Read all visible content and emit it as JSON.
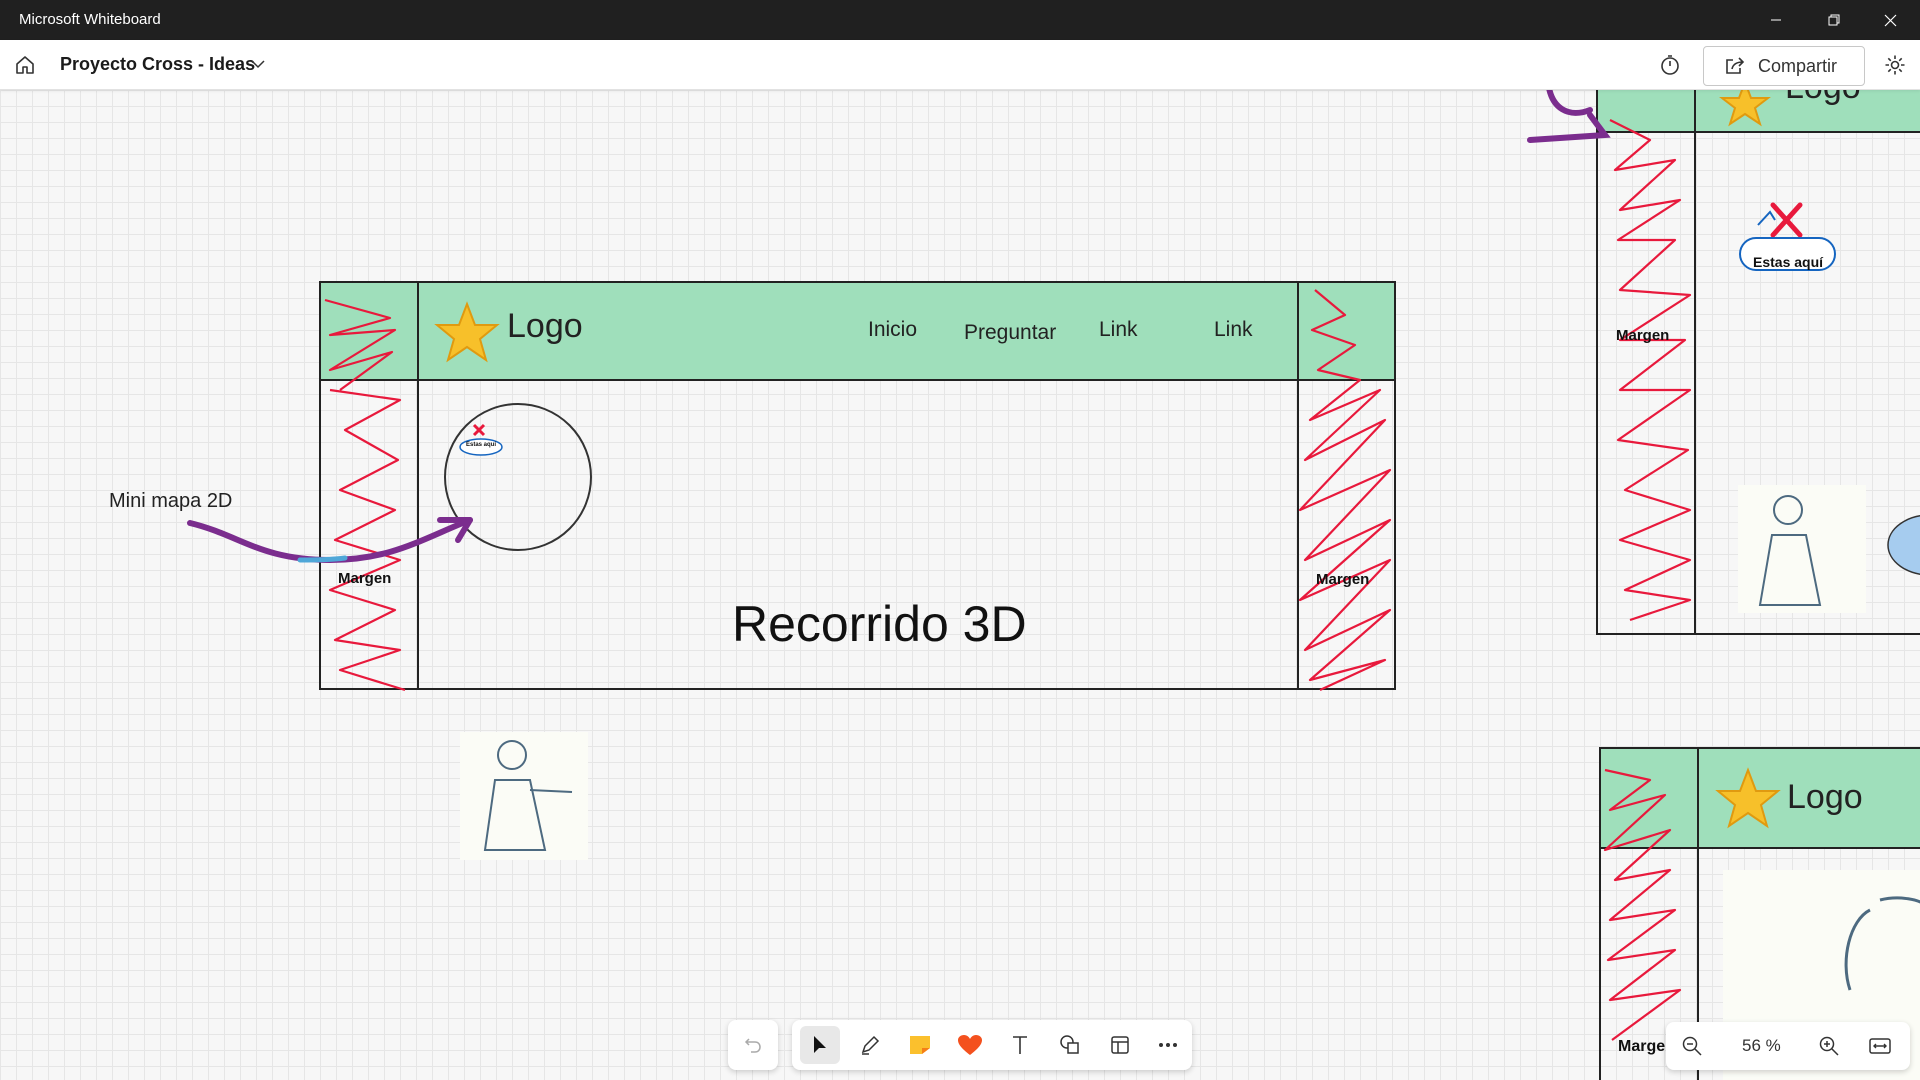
{
  "app": {
    "window_title": "Microsoft Whiteboard"
  },
  "header": {
    "board_name": "Proyecto Cross - Ideas",
    "share_label": "Compartir"
  },
  "board": {
    "main_frame": {
      "logo_text": "Logo",
      "nav": [
        "Inicio",
        "Preguntar",
        "Link",
        "Link"
      ],
      "margin_left": "Margen",
      "margin_right": "Margen",
      "title": "Recorrido 3D",
      "minimap_label": "Estas aquí"
    },
    "annotation_minimap": "Mini mapa 2D",
    "frame_right_top": {
      "logo_text": "Logo",
      "margin": "Margen",
      "here_label": "Estas aquí"
    },
    "frame_right_bottom": {
      "logo_text": "Logo",
      "margin": "Marge"
    }
  },
  "toolbar": {
    "tools": [
      "undo-icon",
      "select-icon",
      "pen-icon",
      "sticky-note-icon",
      "reaction-icon",
      "text-icon",
      "shapes-icon",
      "templates-icon",
      "more-icon"
    ]
  },
  "zoom": {
    "value": "56 %"
  },
  "colors": {
    "green": "#9fdfbb",
    "red": "#e8193c",
    "purple": "#7b2d8e",
    "blue": "#1565c0"
  }
}
